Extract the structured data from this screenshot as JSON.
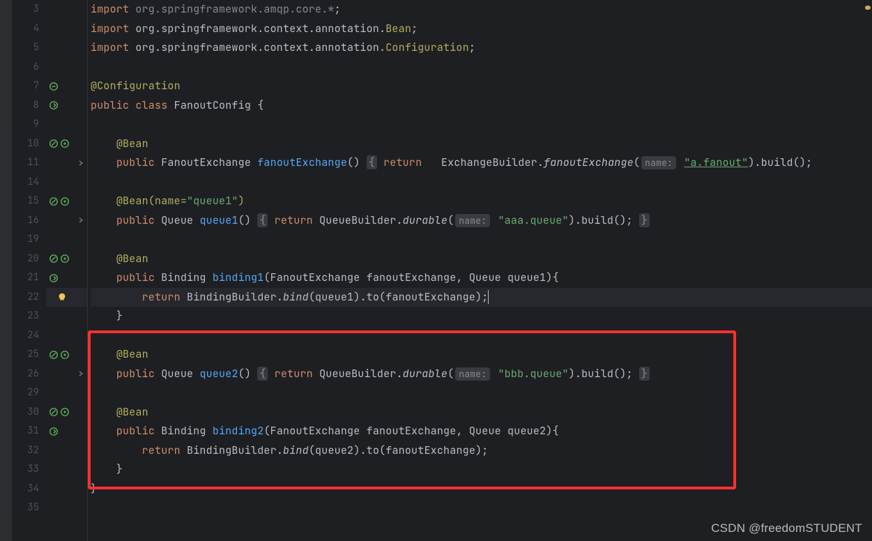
{
  "watermark": "CSDN @freedomSTUDENT",
  "gutter": {
    "lines": [
      "3",
      "4",
      "5",
      "6",
      "7",
      "8",
      "9",
      "10",
      "11",
      "14",
      "15",
      "16",
      "19",
      "20",
      "21",
      "22",
      "23",
      "24",
      "25",
      "26",
      "29",
      "30",
      "31",
      "32",
      "33",
      "34",
      "35"
    ]
  },
  "tokens": {
    "import": "import",
    "public": "public",
    "class": "class",
    "return": "return",
    "pkg_amqp": "org.springframework.amqp.core.*",
    "pkg_bean": "org.springframework.context.annotation.",
    "Bean": "Bean",
    "Configuration": "Configuration",
    "anno_config": "@Configuration",
    "anno_bean": "@Bean",
    "anno_bean_named": "@Bean(name=",
    "queue1_name": "\"queue1\"",
    "class_name": "FanoutConfig",
    "FanoutExchange": "FanoutExchange",
    "fanoutExchange": "fanoutExchange",
    "ExchangeBuilder": "ExchangeBuilder",
    "fanoutExchangeM": "fanoutExchange",
    "name_hint": "name:",
    "a_fanout": "\"a.fanout\"",
    "build": ".build();",
    "Queue": "Queue",
    "queue1": "queue1",
    "queue2": "queue2",
    "QueueBuilder": "QueueBuilder.",
    "durable": "durable",
    "aaa_queue": "\"aaa.queue\"",
    "bbb_queue": "\"bbb.queue\"",
    "Binding": "Binding",
    "binding1": "binding1",
    "binding2": "binding2",
    "BindingBuilder": "BindingBuilder.",
    "bind": "bind",
    "to": ".to(fanoutExchange);",
    "sig_fanout_q1": "(FanoutExchange fanoutExchange, Queue queue1){",
    "sig_fanout_q2": "(FanoutExchange fanoutExchange, Queue queue2){",
    "close_brace": "}",
    "open_fold": "{",
    "close_fold": "}",
    "paren_open": "(",
    "paren_close": ")",
    "empty_parens": "()",
    "semi": ";"
  },
  "icons": {
    "bean_pair": true,
    "bean_single": true,
    "bulb": true,
    "fold": true
  }
}
